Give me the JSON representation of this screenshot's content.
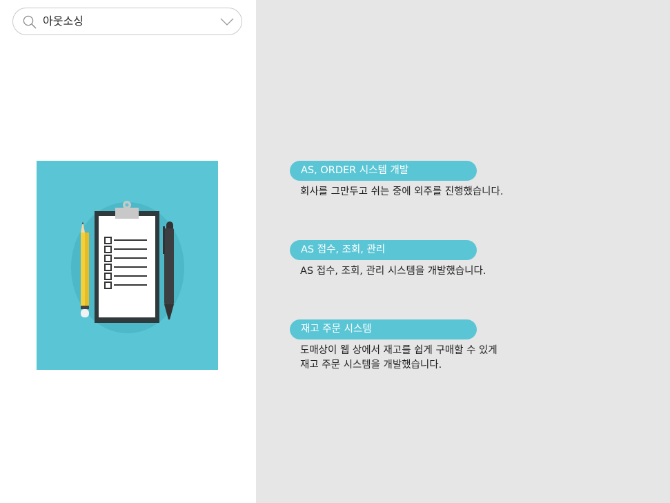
{
  "search": {
    "query": "아웃소싱",
    "icon": "search-icon",
    "dropdown_icon": "chevron-down-icon"
  },
  "illustration": {
    "icon": "clipboard-checklist-icon",
    "background_color": "#5ac6d5"
  },
  "colors": {
    "accent": "#5ac6d5",
    "right_panel_bg": "#e6e6e6"
  },
  "projects": [
    {
      "title": "AS, ORDER 시스템 개발",
      "description": "회사를 그만두고 쉬는 중에 외주를 진행했습니다."
    },
    {
      "title": "AS 접수, 조회, 관리",
      "description": "AS 접수, 조회, 관리 시스템을 개발했습니다."
    },
    {
      "title": "재고 주문 시스템",
      "description": "도매상이 웹 상에서 재고를 쉽게 구매할 수 있게\n재고 주문 시스템을 개발했습니다."
    }
  ]
}
